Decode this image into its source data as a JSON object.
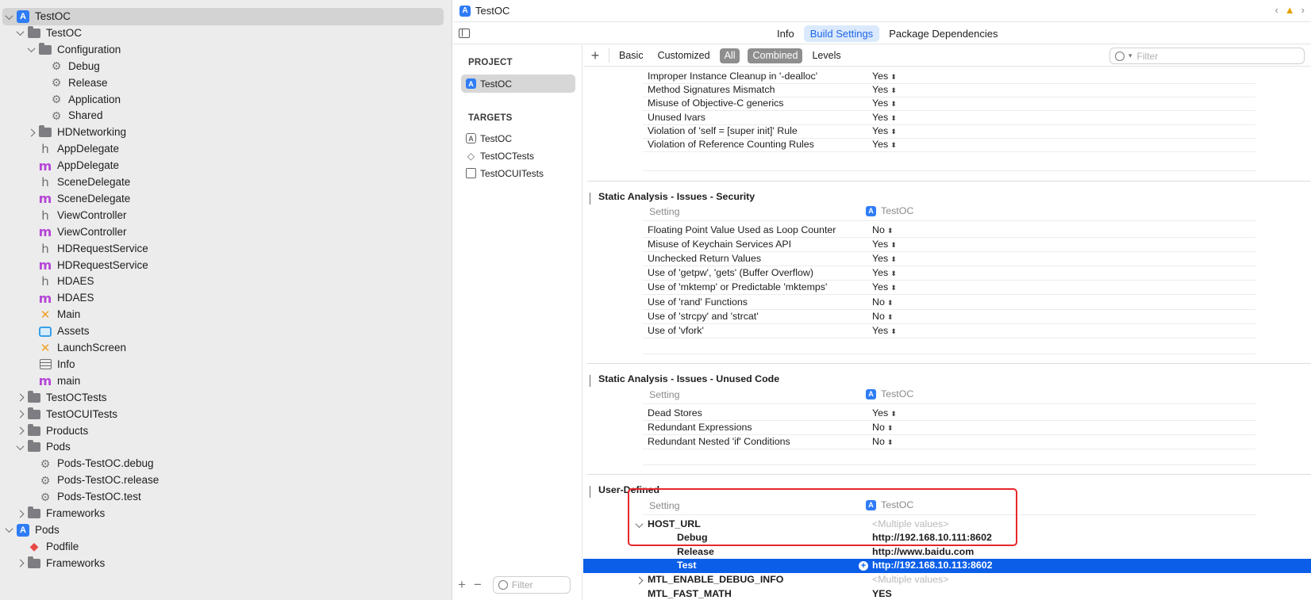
{
  "navigator": {
    "rows": [
      {
        "label": "TestOC",
        "icon": "project-icon",
        "depth": 0,
        "chevron": "down",
        "selected": true
      },
      {
        "label": "TestOC",
        "icon": "folder-icon",
        "depth": 1,
        "chevron": "down"
      },
      {
        "label": "Configuration",
        "icon": "folder-icon",
        "depth": 2,
        "chevron": "down"
      },
      {
        "label": "Debug",
        "icon": "gear-icon",
        "depth": 3
      },
      {
        "label": "Release",
        "icon": "gear-icon",
        "depth": 3
      },
      {
        "label": "Application",
        "icon": "gear-icon",
        "depth": 3
      },
      {
        "label": "Shared",
        "icon": "gear-icon",
        "depth": 3
      },
      {
        "label": "HDNetworking",
        "icon": "folder-icon",
        "depth": 2,
        "chevron": "right"
      },
      {
        "label": "AppDelegate",
        "icon": "header-file-icon",
        "depth": 2
      },
      {
        "label": "AppDelegate",
        "icon": "objc-file-icon",
        "depth": 2
      },
      {
        "label": "SceneDelegate",
        "icon": "header-file-icon",
        "depth": 2
      },
      {
        "label": "SceneDelegate",
        "icon": "objc-file-icon",
        "depth": 2
      },
      {
        "label": "ViewController",
        "icon": "header-file-icon",
        "depth": 2
      },
      {
        "label": "ViewController",
        "icon": "objc-file-icon",
        "depth": 2
      },
      {
        "label": "HDRequestService",
        "icon": "header-file-icon",
        "depth": 2
      },
      {
        "label": "HDRequestService",
        "icon": "objc-file-icon",
        "depth": 2
      },
      {
        "label": "HDAES",
        "icon": "header-file-icon",
        "depth": 2
      },
      {
        "label": "HDAES",
        "icon": "objc-file-icon",
        "depth": 2
      },
      {
        "label": "Main",
        "icon": "storyboard-icon",
        "depth": 2
      },
      {
        "label": "Assets",
        "icon": "asset-catalog-icon",
        "depth": 2
      },
      {
        "label": "LaunchScreen",
        "icon": "storyboard-icon",
        "depth": 2
      },
      {
        "label": "Info",
        "icon": "plist-icon",
        "depth": 2
      },
      {
        "label": "main",
        "icon": "objc-file-icon",
        "depth": 2
      },
      {
        "label": "TestOCTests",
        "icon": "folder-icon",
        "depth": 1,
        "chevron": "right"
      },
      {
        "label": "TestOCUITests",
        "icon": "folder-icon",
        "depth": 1,
        "chevron": "right"
      },
      {
        "label": "Products",
        "icon": "folder-icon",
        "depth": 1,
        "chevron": "right"
      },
      {
        "label": "Pods",
        "icon": "folder-icon",
        "depth": 1,
        "chevron": "down"
      },
      {
        "label": "Pods-TestOC.debug",
        "icon": "gear-icon",
        "depth": 2
      },
      {
        "label": "Pods-TestOC.release",
        "icon": "gear-icon",
        "depth": 2
      },
      {
        "label": "Pods-TestOC.test",
        "icon": "gear-icon",
        "depth": 2
      },
      {
        "label": "Frameworks",
        "icon": "folder-icon",
        "depth": 1,
        "chevron": "right"
      },
      {
        "label": "Pods",
        "icon": "project-icon",
        "depth": 0,
        "chevron": "down"
      },
      {
        "label": "Podfile",
        "icon": "ruby-gem-icon",
        "depth": 1
      },
      {
        "label": "Frameworks",
        "icon": "folder-icon",
        "depth": 1,
        "chevron": "right"
      }
    ]
  },
  "jumpbar": {
    "crumb": "TestOC"
  },
  "tabs": [
    {
      "label": "Info",
      "active": false
    },
    {
      "label": "Build Settings",
      "active": true
    },
    {
      "label": "Package Dependencies",
      "active": false
    }
  ],
  "targets": {
    "project_header": "PROJECT",
    "project": "TestOC",
    "targets_header": "TARGETS",
    "items": [
      {
        "label": "TestOC",
        "icon": "app-target-icon"
      },
      {
        "label": "TestOCTests",
        "icon": "test-target-icon"
      },
      {
        "label": "TestOCUITests",
        "icon": "ui-test-target-icon"
      }
    ],
    "filter_placeholder": "Filter"
  },
  "toolbar": {
    "add": "+",
    "scopes": [
      {
        "label": "Basic",
        "on": false
      },
      {
        "label": "Customized",
        "on": false
      },
      {
        "label": "All",
        "on": true
      }
    ],
    "views": [
      {
        "label": "Combined",
        "on": true
      },
      {
        "label": "Levels",
        "on": false
      }
    ],
    "filter_placeholder": "Filter"
  },
  "settings": {
    "column_setting": "Setting",
    "column_target": "TestOC",
    "top_rows": [
      {
        "name": "Improper Instance Cleanup in '-dealloc'",
        "value": "Yes"
      },
      {
        "name": "Method Signatures Mismatch",
        "value": "Yes"
      },
      {
        "name": "Misuse of Objective-C generics",
        "value": "Yes"
      },
      {
        "name": "Unused Ivars",
        "value": "Yes"
      },
      {
        "name": "Violation of 'self = [super init]' Rule",
        "value": "Yes"
      },
      {
        "name": "Violation of Reference Counting Rules",
        "value": "Yes"
      }
    ],
    "security": {
      "title": "Static Analysis - Issues - Security",
      "rows": [
        {
          "name": "Floating Point Value Used as Loop Counter",
          "value": "No"
        },
        {
          "name": "Misuse of Keychain Services API",
          "value": "Yes"
        },
        {
          "name": "Unchecked Return Values",
          "value": "Yes"
        },
        {
          "name": "Use of 'getpw', 'gets' (Buffer Overflow)",
          "value": "Yes"
        },
        {
          "name": "Use of 'mktemp' or Predictable 'mktemps'",
          "value": "Yes"
        },
        {
          "name": "Use of 'rand' Functions",
          "value": "No"
        },
        {
          "name": "Use of 'strcpy' and 'strcat'",
          "value": "No"
        },
        {
          "name": "Use of 'vfork'",
          "value": "Yes"
        }
      ]
    },
    "unused": {
      "title": "Static Analysis - Issues - Unused Code",
      "rows": [
        {
          "name": "Dead Stores",
          "value": "Yes"
        },
        {
          "name": "Redundant Expressions",
          "value": "No"
        },
        {
          "name": "Redundant Nested 'if' Conditions",
          "value": "No"
        }
      ]
    },
    "user_defined": {
      "title": "User-Defined",
      "host_url": {
        "name": "HOST_URL",
        "value": "<Multiple values>"
      },
      "configs": [
        {
          "name": "Debug",
          "value": "http://192.168.10.111:8602",
          "selected": false
        },
        {
          "name": "Release",
          "value": "http://www.baidu.com",
          "selected": false
        },
        {
          "name": "Test",
          "value": "http://192.168.10.113:8602",
          "selected": true
        }
      ],
      "mtl_debug": {
        "name": "MTL_ENABLE_DEBUG_INFO",
        "value": "<Multiple values>"
      },
      "mtl_fast": {
        "name": "MTL_FAST_MATH",
        "value": "YES"
      }
    }
  },
  "colors": {
    "accent": "#0b5ee8",
    "highlight_box": "#e8262c",
    "selected_tab_bg": "#dbe9fd"
  }
}
